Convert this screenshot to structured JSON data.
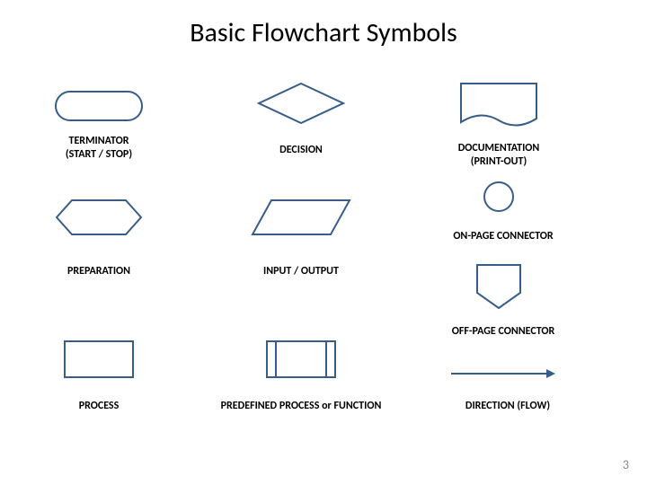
{
  "title": "Basic Flowchart Symbols",
  "page_number": "3",
  "stroke": "#385d8a",
  "fill": "#ffffff",
  "symbols": {
    "terminator": {
      "label": "TERMINATOR\n(START / STOP)"
    },
    "decision": {
      "label": "DECISION"
    },
    "documentation": {
      "label": "DOCUMENTATION\n(PRINT-OUT)"
    },
    "preparation": {
      "label": "PREPARATION"
    },
    "input_output": {
      "label": "INPUT / OUTPUT"
    },
    "on_page_connector": {
      "label": "ON-PAGE CONNECTOR"
    },
    "process": {
      "label": "PROCESS"
    },
    "predefined_process": {
      "label": "PREDEFINED PROCESS or FUNCTION"
    },
    "off_page_connector": {
      "label": "OFF-PAGE CONNECTOR"
    },
    "direction": {
      "label": "DIRECTION (FLOW)"
    }
  }
}
